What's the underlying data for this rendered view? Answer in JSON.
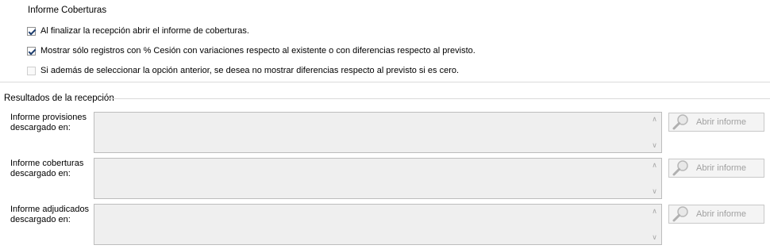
{
  "informe": {
    "title": "Informe Coberturas",
    "options": [
      {
        "label": "Al finalizar la recepción abrir el informe de coberturas.",
        "checked": true
      },
      {
        "label": "Mostrar sólo registros con % Cesión con variaciones respecto al existente o con diferencias respecto al previsto.",
        "checked": true
      },
      {
        "label": "Si además de seleccionar la opción anterior, se desea no mostrar diferencias respecto al previsto si es cero.",
        "checked": false
      }
    ]
  },
  "resultados": {
    "title": "Resultados de la recepción",
    "rows": [
      {
        "label": "Informe provisiones descargado en:",
        "value": "",
        "button": "Abrir informe"
      },
      {
        "label": "Informe coberturas descargado en:",
        "value": "",
        "button": "Abrir informe"
      },
      {
        "label": "Informe adjudicados descargado en:",
        "value": "",
        "button": "Abrir informe"
      }
    ]
  },
  "icons": {
    "scroll_up": "chevron-up-icon",
    "scroll_down": "chevron-down-icon",
    "button_icon": "magnifier-icon"
  }
}
